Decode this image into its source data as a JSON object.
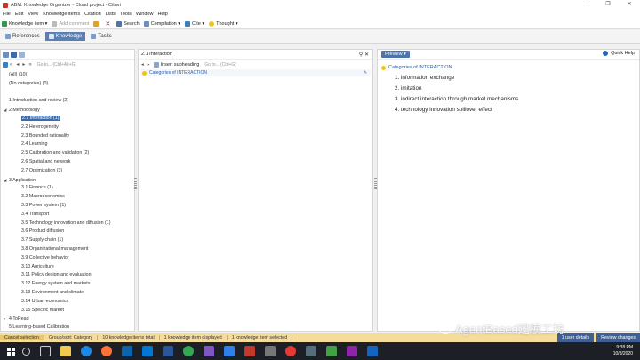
{
  "window": {
    "title": "ABM: Knowledge Organizer - Cloud project - Citavi",
    "controls": [
      "—",
      "❐",
      "✕"
    ]
  },
  "menu": [
    "File",
    "Edit",
    "View",
    "Knowledge items",
    "Citation",
    "Lists",
    "Tools",
    "Window",
    "Help"
  ],
  "toolbar": {
    "knowledge_item": "Knowledge item ▾",
    "add_comment": "Add comment",
    "search": "Search",
    "compilation": "Compilation ▾",
    "cite": "Cite ▾",
    "thought": "Thought ▾"
  },
  "tabs": [
    "References",
    "Knowledge",
    "Tasks"
  ],
  "left": {
    "goto_hint": "Go to... (Ctrl+Alt+G)",
    "tree": [
      {
        "label": "(All) (10)",
        "level": 0,
        "tri": ""
      },
      {
        "label": "(No categories) (0)",
        "level": 0,
        "tri": ""
      },
      {
        "label": "",
        "level": 0,
        "tri": ""
      },
      {
        "label": "1 Introduction and review (2)",
        "level": 0,
        "tri": ""
      },
      {
        "label": "2 Methodology",
        "level": 0,
        "tri": "◢"
      },
      {
        "label": "2.1 Interaction (1)",
        "level": 1,
        "tri": "",
        "selected": true
      },
      {
        "label": "2.2 Heterogeneity",
        "level": 1,
        "tri": ""
      },
      {
        "label": "2.3 Bounded rationality",
        "level": 1,
        "tri": ""
      },
      {
        "label": "2.4 Learning",
        "level": 1,
        "tri": ""
      },
      {
        "label": "2.5 Calibration and validation (2)",
        "level": 1,
        "tri": ""
      },
      {
        "label": "2.6 Spatial and network",
        "level": 1,
        "tri": ""
      },
      {
        "label": "2.7 Optimization (3)",
        "level": 1,
        "tri": ""
      },
      {
        "label": "3 Application",
        "level": 0,
        "tri": "◢"
      },
      {
        "label": "3.1 Finance (1)",
        "level": 1,
        "tri": ""
      },
      {
        "label": "3.2 Macroeconomics",
        "level": 1,
        "tri": ""
      },
      {
        "label": "3.3 Power system (1)",
        "level": 1,
        "tri": ""
      },
      {
        "label": "3.4 Transport",
        "level": 1,
        "tri": ""
      },
      {
        "label": "3.5 Technology innovation and diffusion (1)",
        "level": 1,
        "tri": ""
      },
      {
        "label": "3.6 Product diffusion",
        "level": 1,
        "tri": ""
      },
      {
        "label": "3.7 Supply chain (1)",
        "level": 1,
        "tri": ""
      },
      {
        "label": "3.8 Organizational management",
        "level": 1,
        "tri": ""
      },
      {
        "label": "3.9 Collective behavior",
        "level": 1,
        "tri": ""
      },
      {
        "label": "3.10 Agriculture",
        "level": 1,
        "tri": ""
      },
      {
        "label": "3.11 Policy design and evaluation",
        "level": 1,
        "tri": ""
      },
      {
        "label": "3.12 Energy system and markets",
        "level": 1,
        "tri": ""
      },
      {
        "label": "3.13 Environment and climate",
        "level": 1,
        "tri": ""
      },
      {
        "label": "3.14 Urban economics",
        "level": 1,
        "tri": ""
      },
      {
        "label": "3.15 Specific market",
        "level": 1,
        "tri": ""
      },
      {
        "label": "4 ToRead",
        "level": 0,
        "tri": "▸"
      },
      {
        "label": "5 Learning-based Calibration",
        "level": 0,
        "tri": ""
      }
    ]
  },
  "middle": {
    "header": "2.1 Interaction",
    "insert_subheading": "Insert subheading",
    "goto_hint": "Go to... (Ctrl+G)",
    "category_line": "Categories of INTERACTION"
  },
  "right": {
    "preview_label": "Preview ▾",
    "quick_help": "Quick Help",
    "category_title": "Categories of INTERACTION",
    "items": [
      "1. information exchange",
      "2. imitation",
      "3. indirect interaction through market mechanisms",
      "4. technology innovation spillover effect"
    ]
  },
  "status": {
    "cancel": "Cancel selection",
    "group_sort": "Group/sort: Category",
    "total": "10 knowledge items total",
    "displayed": "1 knowledge item displayed",
    "selected": "1 knowledge item selected",
    "user_details": "1 user details",
    "review": "Review changes"
  },
  "watermark": "AgentBased建模工坊",
  "clock": {
    "time": "9:38 PM",
    "date": "10/8/2020"
  },
  "colors": {
    "accent": "#3d6aaa",
    "status_bar": "#f5dc9a",
    "taskbar": "#1d1f26"
  }
}
